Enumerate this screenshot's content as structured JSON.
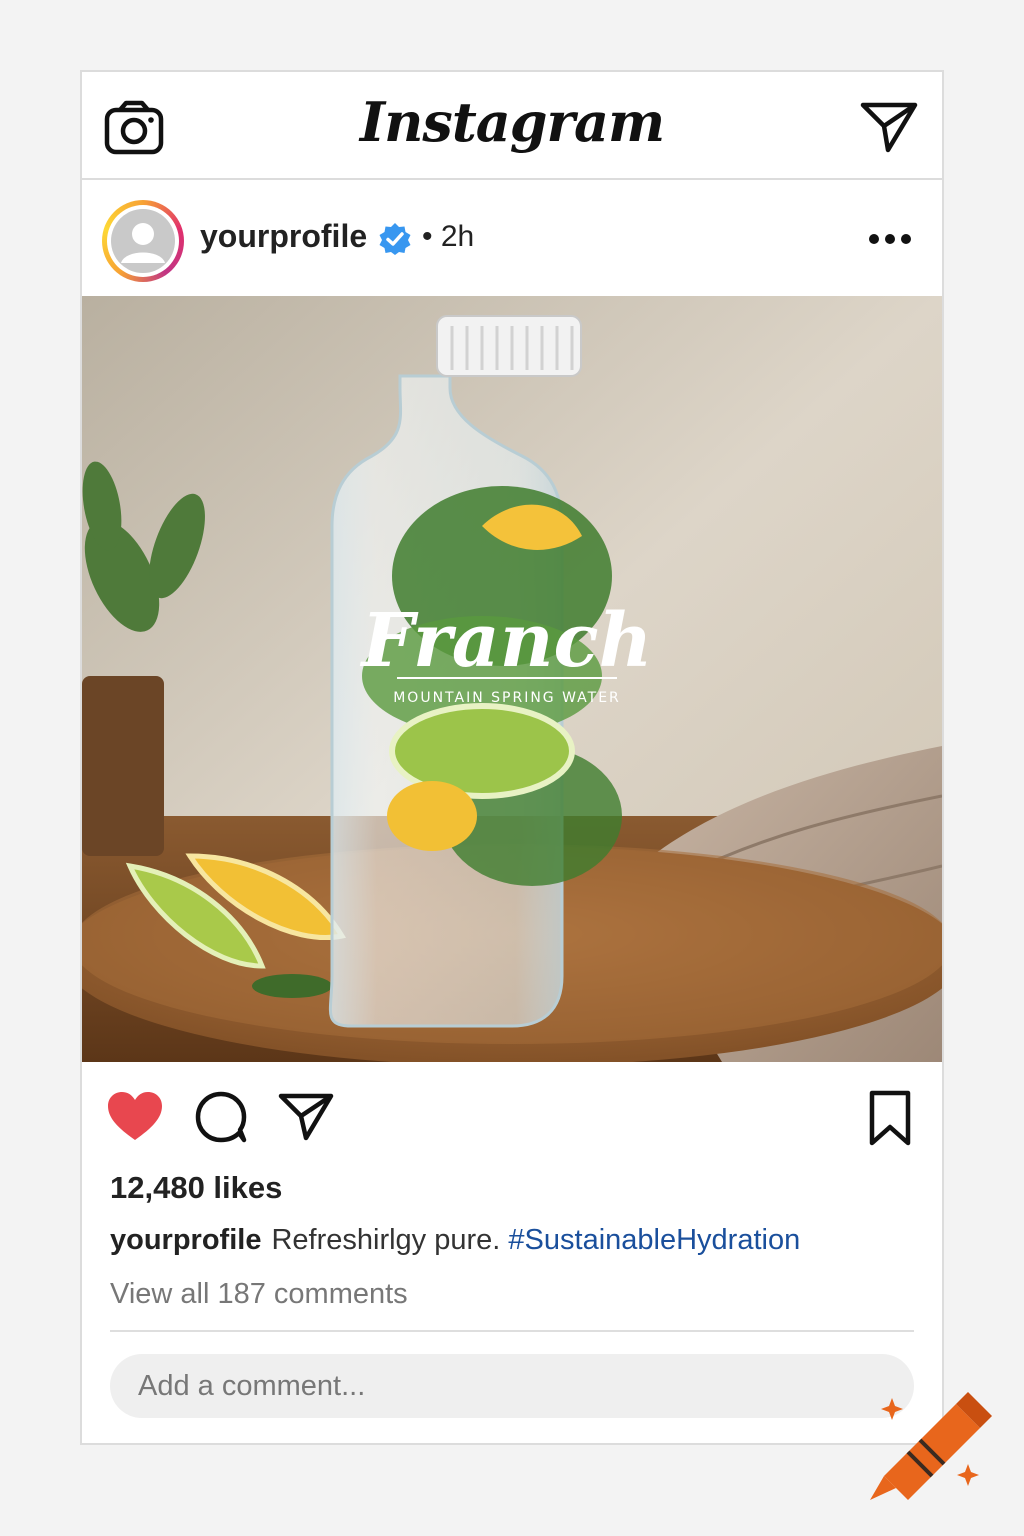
{
  "header": {
    "brand": "Instagram",
    "camera_icon": "camera-icon",
    "send_icon": "paper-plane-icon"
  },
  "post": {
    "username": "yourprofile",
    "verified": true,
    "time_label": "• 2h",
    "more_icon": "more-dots-icon",
    "image": {
      "product_brand": "Franch",
      "product_tagline": "MOUNTAIN SPRING WATER"
    },
    "likes": "12,480 likes",
    "caption": {
      "username": "yourprofile",
      "text": "Refreshirlgy pure.",
      "hashtag": "#SustainableHydration"
    },
    "view_comments": "View all 187 comments",
    "comment_placeholder": "Add a comment..."
  },
  "colors": {
    "like": "#e8474f",
    "verified": "#3897f0",
    "hashtag": "#1a4f9c",
    "logo": "#e8661c"
  }
}
